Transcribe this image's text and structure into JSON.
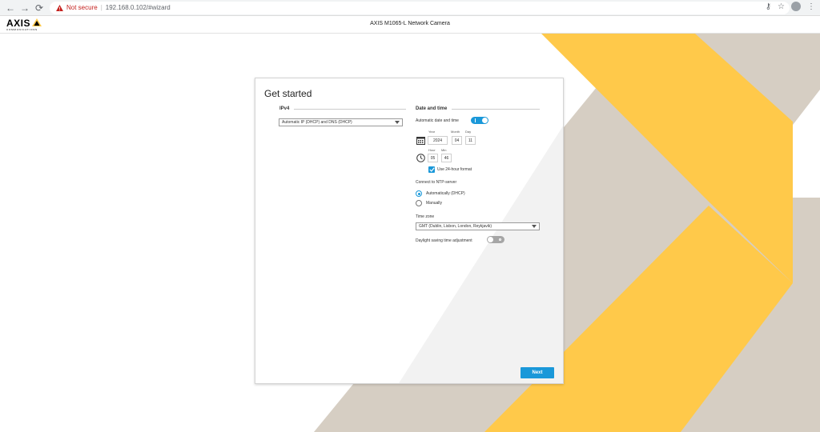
{
  "browser": {
    "back_icon": "arrow-left-icon",
    "forward_icon": "arrow-right-icon",
    "reload_icon": "reload-icon",
    "security_label": "Not secure",
    "url": "192.168.0.102/#wizard",
    "security_color": "#c5221f"
  },
  "header": {
    "logo_text": "AXIS",
    "logo_subtext": "COMMUNICATIONS",
    "title": "AXIS M1065-L Network Camera"
  },
  "colors": {
    "yellow": "#ffc94a",
    "taupe": "#d6cec3",
    "accent": "#1a98d9"
  },
  "wizard": {
    "title": "Get started",
    "ipv4": {
      "heading": "IPv4",
      "mode": "Automatic IP (DHCP) and DNS (DHCP)"
    },
    "datetime": {
      "heading": "Date and time",
      "auto_label": "Automatic date and time",
      "auto_enabled": true,
      "year_label": "Year",
      "month_label": "Month",
      "day_label": "Day",
      "year": "2024",
      "month": "04",
      "day": "11",
      "hour_label": "Hour",
      "min_label": "Min",
      "hour": "05",
      "min": "46",
      "format24_label": "Use 24-hour format",
      "format24_checked": true
    },
    "ntp": {
      "label": "Connect to NTP-server",
      "options": [
        "Automatically (DHCP)",
        "Manually"
      ],
      "selected": "Automatically (DHCP)"
    },
    "timezone": {
      "label": "Time zone",
      "value": "GMT (Dublin, Lisbon, London, Reykjavik)"
    },
    "dst": {
      "label": "Daylight saving time adjustment",
      "enabled": false
    },
    "next_label": "Next"
  }
}
